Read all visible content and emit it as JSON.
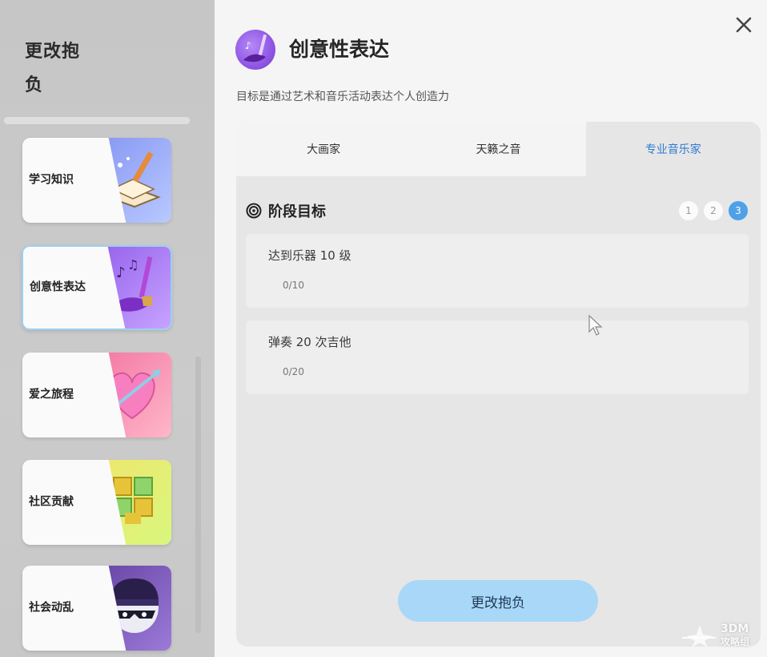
{
  "sidebar": {
    "title": "更改抱负",
    "cards": [
      {
        "label": "学习知识",
        "icon": "book-pencil-icon",
        "colors": [
          "#7c8cf0",
          "#b9c9ff"
        ]
      },
      {
        "label": "创意性表达",
        "icon": "brush-music-icon",
        "colors": [
          "#8a53e8",
          "#c7a3ff"
        ]
      },
      {
        "label": "爱之旅程",
        "icon": "heart-arrow-icon",
        "colors": [
          "#f06b9c",
          "#ffb6c9"
        ]
      },
      {
        "label": "社区贡献",
        "icon": "puzzle-blocks-icon",
        "colors": [
          "#f2e36b",
          "#d9f77d"
        ]
      },
      {
        "label": "社会动乱",
        "icon": "masked-face-icon",
        "colors": [
          "#5b3a9a",
          "#9b7ad8"
        ]
      }
    ]
  },
  "panel": {
    "icon": "brush-music-icon",
    "title": "创意性表达",
    "subtitle": "目标是通过艺术和音乐活动表达个人创造力",
    "tabs": [
      {
        "label": "大画家"
      },
      {
        "label": "天籁之音"
      },
      {
        "label": "专业音乐家"
      }
    ],
    "active_tab": 2,
    "stage": {
      "label": "阶段目标",
      "steps": [
        "1",
        "2",
        "3"
      ],
      "current_step": 3
    },
    "goals": [
      {
        "name": "达到乐器 10 级",
        "progress": "0/10"
      },
      {
        "name": "弹奏 20 次吉他",
        "progress": "0/20"
      }
    ],
    "button": "更改抱负"
  },
  "watermark": {
    "text": "3DM",
    "subtext": "攻略组"
  },
  "colors": {
    "accent": "#4ea1e6",
    "button": "#a9d7f7",
    "active_tab_text": "#2f7ad1"
  }
}
